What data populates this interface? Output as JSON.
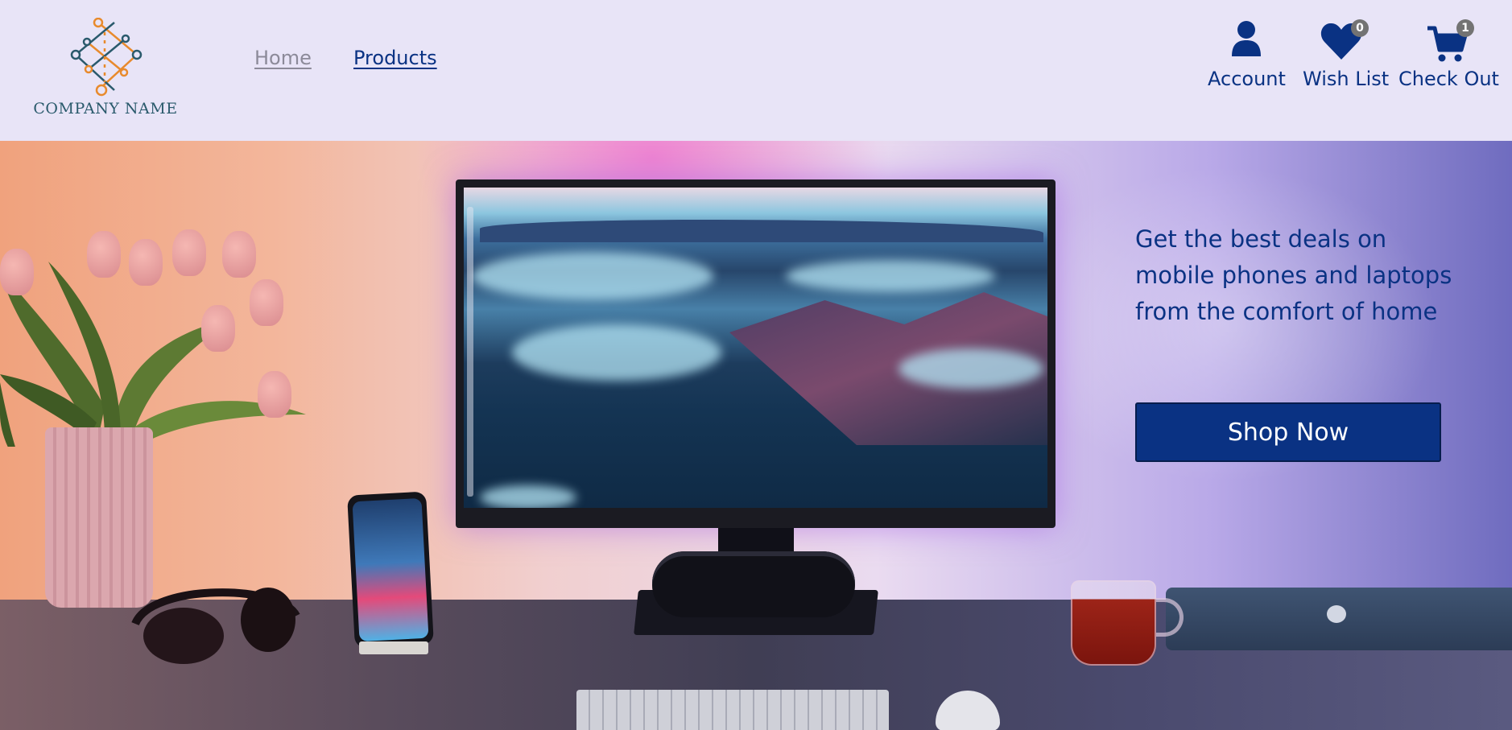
{
  "brand": {
    "name": "COMPANY NAME",
    "logo_icon": "diamond-network-logo"
  },
  "nav": {
    "home_label": "Home",
    "products_label": "Products"
  },
  "header_actions": {
    "account": {
      "label": "Account",
      "icon": "user-icon"
    },
    "wishlist": {
      "label": "Wish List",
      "icon": "heart-icon",
      "count": "0"
    },
    "checkout": {
      "label": "Check Out",
      "icon": "cart-icon",
      "count": "1"
    }
  },
  "hero": {
    "tagline": "Get the best deals on mobile phones and laptops from the comfort of home",
    "cta_label": "Shop Now",
    "image_alt": "desk setup with monitor, phone and tulips"
  },
  "colors": {
    "background": "#e8e4f7",
    "brand_blue": "#0a3283",
    "badge_grey": "#737373",
    "muted_link": "#8c8a99"
  }
}
